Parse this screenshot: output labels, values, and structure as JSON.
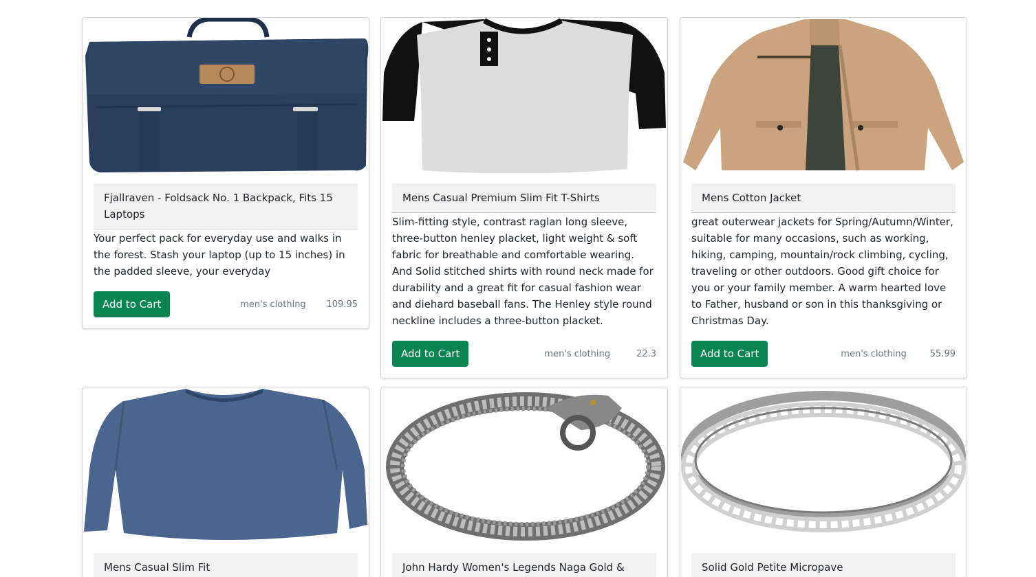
{
  "products": [
    {
      "title": "Fjallraven - Foldsack No. 1 Backpack, Fits 15 Laptops",
      "description": "Your perfect pack for everyday use and walks in the forest. Stash your laptop (up to 15 inches) in the padded sleeve, your everyday",
      "button": "Add to Cart",
      "category": "men's clothing",
      "price": "109.95",
      "image": "backpack-image"
    },
    {
      "title": "Mens Casual Premium Slim Fit T-Shirts",
      "description": "Slim-fitting style, contrast raglan long sleeve, three-button henley placket, light weight & soft fabric for breathable and comfortable wearing. And Solid stitched shirts with round neck made for durability and a great fit for casual fashion wear and diehard baseball fans. The Henley style round neckline includes a three-button placket.",
      "button": "Add to Cart",
      "category": "men's clothing",
      "price": "22.3",
      "image": "tshirt-image"
    },
    {
      "title": "Mens Cotton Jacket",
      "description": "great outerwear jackets for Spring/Autumn/Winter, suitable for many occasions, such as working, hiking, camping, mountain/rock climbing, cycling, traveling or other outdoors. Good gift choice for you or your family member. A warm hearted love to Father, husband or son in this thanksgiving or Christmas Day.",
      "button": "Add to Cart",
      "category": "men's clothing",
      "price": "55.99",
      "image": "jacket-image"
    },
    {
      "title": "Mens Casual Slim Fit",
      "image": "longsleeve-shirt-image"
    },
    {
      "title": "John Hardy Women's Legends Naga Gold & Silver",
      "image": "bracelet-image"
    },
    {
      "title": "Solid Gold Petite Micropave",
      "image": "ring-image"
    }
  ],
  "colors": {
    "button": "#0a8552",
    "header_bg": "#f2f2f2",
    "muted": "#6c757d"
  }
}
